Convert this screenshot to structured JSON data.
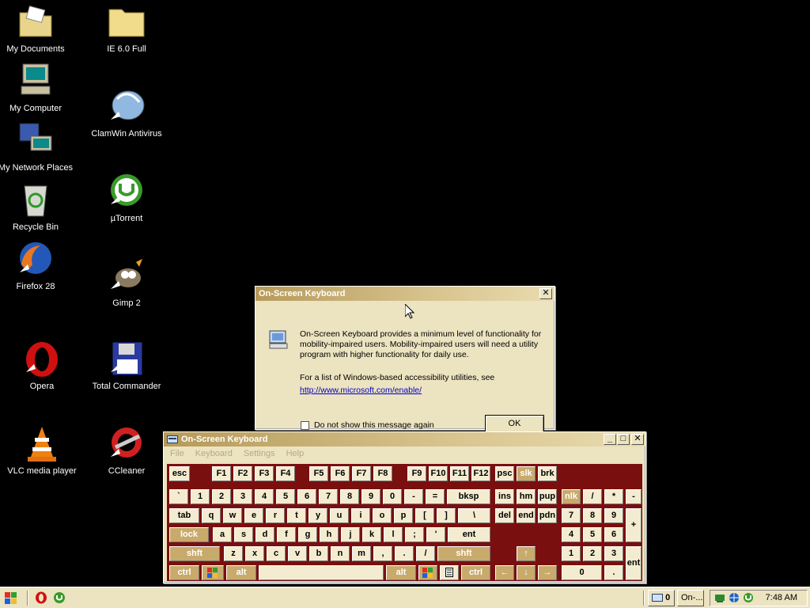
{
  "desktop": {
    "icons": [
      {
        "label": "My Documents"
      },
      {
        "label": "My Computer"
      },
      {
        "label": "My Network Places"
      },
      {
        "label": "Recycle Bin"
      },
      {
        "label": "Firefox 28"
      },
      {
        "label": "Opera"
      },
      {
        "label": "VLC media player"
      },
      {
        "label": "IE 6.0 Full"
      },
      {
        "label": "ClamWin Antivirus"
      },
      {
        "label": "µTorrent"
      },
      {
        "label": "Gimp 2"
      },
      {
        "label": "Total Commander"
      },
      {
        "label": "CCleaner"
      }
    ]
  },
  "dialog": {
    "title": "On-Screen Keyboard",
    "message": "On-Screen Keyboard provides a minimum level of functionality for mobility-impaired users. Mobility-impaired users will need a utility program with higher functionality for daily use.",
    "message2": "For a list of Windows-based accessibility utilities, see",
    "link": "http://www.microsoft.com/enable/",
    "checkbox_label": "Do not show this message again",
    "ok_label": "OK",
    "close_glyph": "✕"
  },
  "osk": {
    "title": "On-Screen Keyboard",
    "menu": [
      "File",
      "Keyboard",
      "Settings",
      "Help"
    ],
    "keys": {
      "esc": "esc",
      "f1": "F1",
      "f2": "F2",
      "f3": "F3",
      "f4": "F4",
      "f5": "F5",
      "f6": "F6",
      "f7": "F7",
      "f8": "F8",
      "f9": "F9",
      "f10": "F10",
      "f11": "F11",
      "f12": "F12",
      "psc": "psc",
      "slk": "slk",
      "brk": "brk",
      "backtick": "`",
      "n1": "1",
      "n2": "2",
      "n3": "3",
      "n4": "4",
      "n5": "5",
      "n6": "6",
      "n7": "7",
      "n8": "8",
      "n9": "9",
      "n0": "0",
      "minus": "-",
      "equals": "=",
      "bksp": "bksp",
      "ins": "ins",
      "hm": "hm",
      "pup": "pup",
      "nlk": "nlk",
      "kp_div": "/",
      "kp_mul": "*",
      "kp_sub": "-",
      "tab": "tab",
      "q": "q",
      "w": "w",
      "e": "e",
      "r": "r",
      "t": "t",
      "y": "y",
      "u": "u",
      "i": "i",
      "o": "o",
      "p": "p",
      "lbr": "[",
      "rbr": "]",
      "bslash": "\\",
      "del": "del",
      "end": "end",
      "pdn": "pdn",
      "kp7": "7",
      "kp8": "8",
      "kp9": "9",
      "kp_add": "+",
      "lock": "lock",
      "a": "a",
      "s": "s",
      "d": "d",
      "f": "f",
      "g": "g",
      "h": "h",
      "j": "j",
      "k": "k",
      "l": "l",
      "semi": ";",
      "quote": "'",
      "ent": "ent",
      "kp4": "4",
      "kp5": "5",
      "kp6": "6",
      "lshft": "shft",
      "z": "z",
      "x": "x",
      "c": "c",
      "v": "v",
      "b": "b",
      "n": "n",
      "m": "m",
      "comma": ",",
      "period": ".",
      "slash": "/",
      "rshft": "shft",
      "up": "↑",
      "kp1": "1",
      "kp2": "2",
      "kp3": "3",
      "kp_ent": "ent",
      "lctrl": "ctrl",
      "lalt": "alt",
      "ralt": "alt",
      "rctrl": "ctrl",
      "left": "←",
      "down": "↓",
      "right": "→",
      "kp0": "0",
      "kp_dot": "."
    }
  },
  "taskbar": {
    "tasks": [
      {
        "label": "0"
      },
      {
        "label": "On-..."
      }
    ],
    "clock": "7:48 AM"
  }
}
